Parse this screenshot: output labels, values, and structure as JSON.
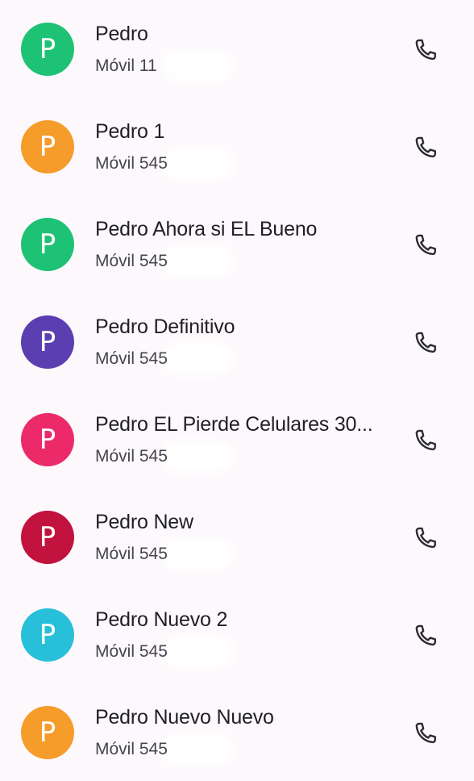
{
  "contacts": [
    {
      "initial": "P",
      "name": "Pedro",
      "detail": "Móvil 11",
      "color": "#1ec274"
    },
    {
      "initial": "P",
      "name": "Pedro 1",
      "detail": "Móvil 545",
      "color": "#f59c2a"
    },
    {
      "initial": "P",
      "name": "Pedro Ahora si EL Bueno",
      "detail": "Móvil 545",
      "color": "#1ec274"
    },
    {
      "initial": "P",
      "name": "Pedro Definitivo",
      "detail": "Móvil 545",
      "color": "#5b3fb0"
    },
    {
      "initial": "P",
      "name": "Pedro EL Pierde Celulares 30...",
      "detail": "Móvil 545",
      "color": "#ec2a6a"
    },
    {
      "initial": "P",
      "name": "Pedro New",
      "detail": "Móvil 545",
      "color": "#c2123e"
    },
    {
      "initial": "P",
      "name": "Pedro Nuevo 2",
      "detail": "Móvil 545",
      "color": "#27c0d8"
    },
    {
      "initial": "P",
      "name": "Pedro Nuevo Nuevo",
      "detail": "Móvil 545",
      "color": "#f59c2a"
    }
  ],
  "icons": {
    "call": "phone-icon"
  }
}
